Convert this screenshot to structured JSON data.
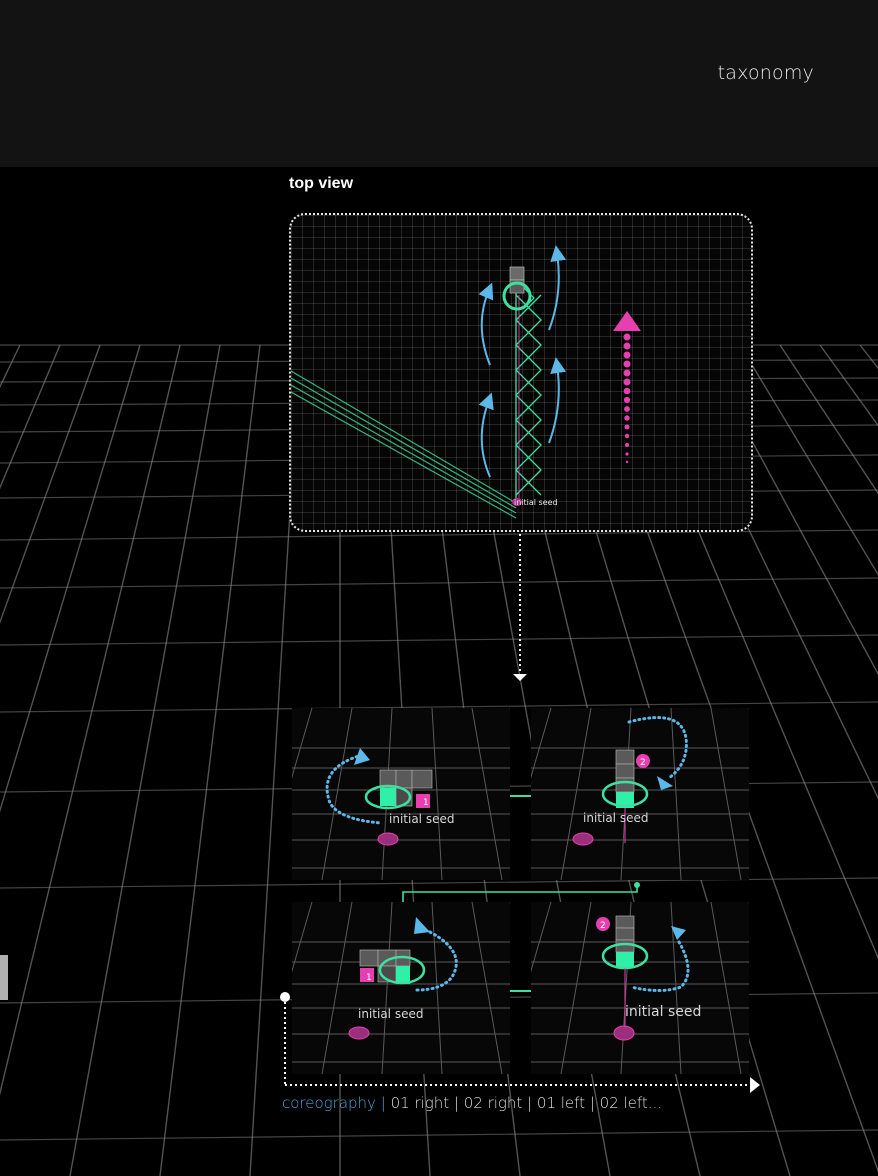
{
  "header": {
    "nav_link": "taxonomy"
  },
  "top_view": {
    "title": "top view",
    "seed_label": "initial seed"
  },
  "steps": [
    {
      "seed_label": "initial seed",
      "badge": "1"
    },
    {
      "seed_label": "initial seed",
      "badge": "2"
    },
    {
      "seed_label": "initial seed",
      "badge": "1"
    },
    {
      "seed_label": "initial seed",
      "badge": "2"
    }
  ],
  "caption": {
    "label": "coreography",
    "separator": "|",
    "sequence": "01 right | 02 right | 01 left | 02 left..."
  },
  "colors": {
    "background": "#000000",
    "header_bg": "#131313",
    "accent_blue": "#4fa3d6",
    "accent_green": "#3ee0a0",
    "accent_pink": "#e83fb0"
  }
}
